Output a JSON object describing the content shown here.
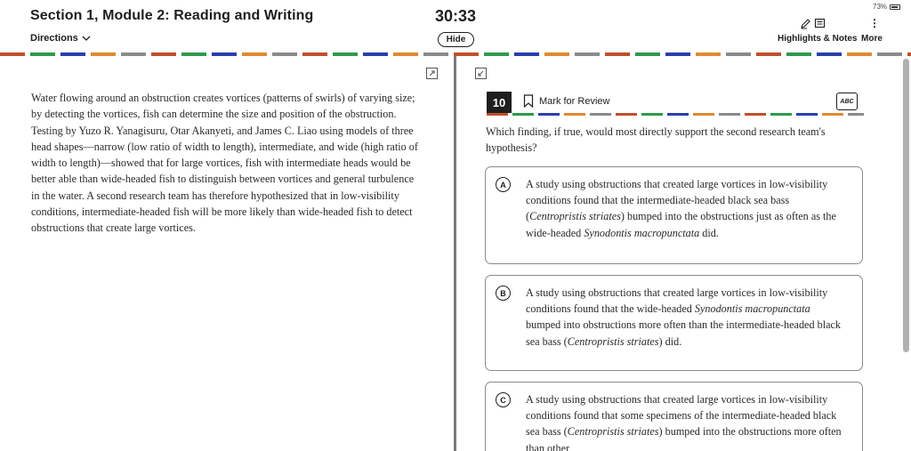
{
  "header": {
    "section_title": "Section 1, Module 2: Reading and Writing",
    "directions_label": "Directions",
    "timer": "30:33",
    "hide_label": "Hide",
    "battery_percent": "73%",
    "highlights_label": "Highlights & Notes",
    "more_label": "More"
  },
  "passage": {
    "text": "Water flowing around an obstruction creates vortices (patterns of swirls) of varying size; by detecting the vortices, fish can determine the size and position of the obstruction. Testing by Yuzo R. Yanagisuru, Otar Akanyeti, and James C. Liao using models of three head shapes—narrow (low ratio of width to length), intermediate, and wide (high ratio of width to length)—showed that for large vortices, fish with intermediate heads would be better able than wide-headed fish to distinguish between vortices and general turbulence in the water. A second research team has therefore hypothesized that in low-visibility conditions, intermediate-headed fish will be more likely than wide-headed fish to detect obstructions that create large vortices."
  },
  "question": {
    "number": "10",
    "mark_label": "Mark for Review",
    "abc_label": "ABC",
    "prompt": "Which finding, if true, would most directly support the second research team's hypothesis?",
    "choices": [
      {
        "letter": "A",
        "parts": [
          "A study using obstructions that created large vortices in low-visibility conditions found that the intermediate-headed black sea bass (",
          "Centropristis striates",
          ") bumped into the obstructions just as often as the wide-headed ",
          "Synodontis macropunctata",
          " did."
        ]
      },
      {
        "letter": "B",
        "parts": [
          "A study using obstructions that created large vortices in low-visibility conditions found that the wide-headed ",
          "Synodontis macropunctata",
          " bumped into obstructions more often than the intermediate-headed black sea bass (",
          "Centropristis striates",
          ") did."
        ]
      },
      {
        "letter": "C",
        "parts": [
          "A study using obstructions that created large vortices in low-visibility conditions found that some specimens of the intermediate-headed black sea bass (",
          "Centropristis striates",
          ") bumped into the obstructions more often than other"
        ]
      }
    ]
  },
  "colors": {
    "dash_palette": [
      "#c0502a",
      "#2e9a4c",
      "#2a3fae",
      "#e08a30",
      "#8a8a8a"
    ]
  }
}
